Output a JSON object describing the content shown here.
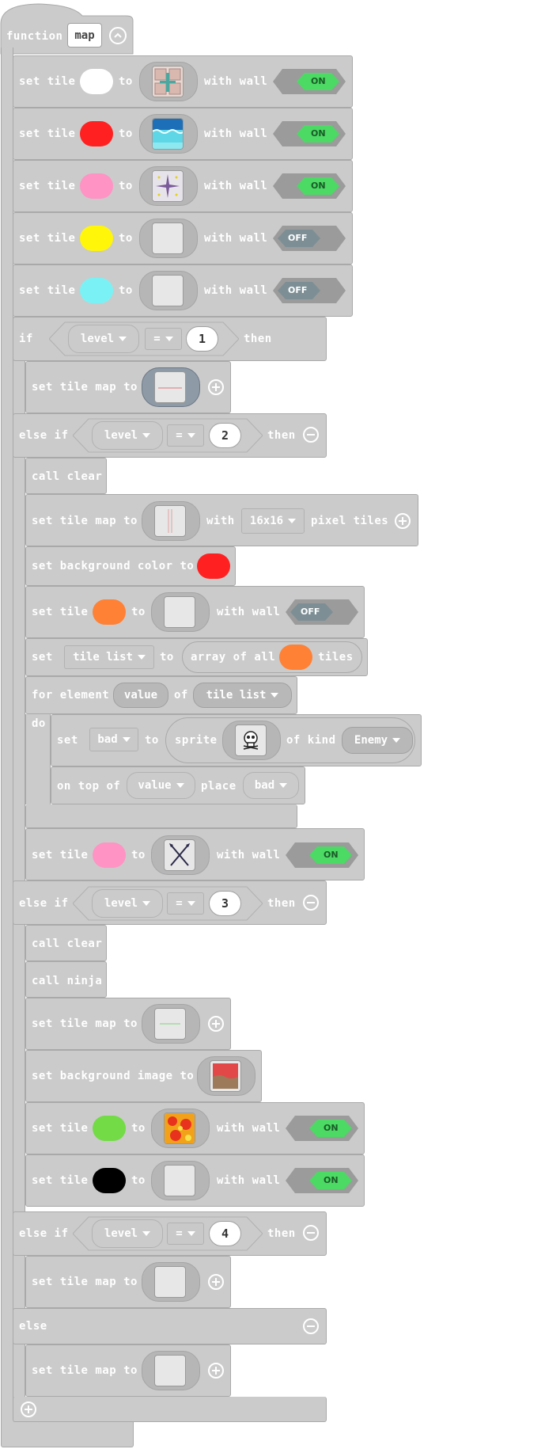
{
  "function": {
    "keyword": "function",
    "name": "map"
  },
  "set_tiles": [
    {
      "prefix": "set tile",
      "color": "#ffffff",
      "to": "to",
      "with_wall": "with wall",
      "wall": "ON",
      "image": "tile-cross"
    },
    {
      "prefix": "set tile",
      "color": "#ff2121",
      "to": "to",
      "with_wall": "with wall",
      "wall": "ON",
      "image": "tile-water"
    },
    {
      "prefix": "set tile",
      "color": "#ff93c4",
      "to": "to",
      "with_wall": "with wall",
      "wall": "ON",
      "image": "tile-star"
    },
    {
      "prefix": "set tile",
      "color": "#fff609",
      "to": "to",
      "with_wall": "with wall",
      "wall": "OFF",
      "image": "tile-empty"
    },
    {
      "prefix": "set tile",
      "color": "#7af2f5",
      "to": "to",
      "with_wall": "with wall",
      "wall": "OFF",
      "image": "tile-empty"
    }
  ],
  "if1": {
    "if": "if",
    "var": "level",
    "op": "=",
    "num": "1",
    "then": "then"
  },
  "if1_body": {
    "set_tilemap": "set tile map to"
  },
  "elif2": {
    "else_if": "else if",
    "var": "level",
    "op": "=",
    "num": "2",
    "then": "then"
  },
  "elif2_body": {
    "call_clear": "call clear",
    "set_tilemap": "set tile map to",
    "with": "with",
    "pixel_size": "16x16",
    "pixel_tiles": "pixel tiles",
    "set_bg_color": "set background color to",
    "bg_color": "#ff2121",
    "set_tile": {
      "prefix": "set tile",
      "color": "#ff8135",
      "to": "to",
      "with_wall": "with wall",
      "wall": "OFF"
    },
    "set_list": {
      "set": "set",
      "var": "tile list",
      "to": "to",
      "array_of_all": "array of all",
      "color": "#ff8135",
      "tiles": "tiles"
    },
    "for_loop": {
      "for_element": "for element",
      "value": "value",
      "of": "of",
      "list": "tile list",
      "do": "do"
    },
    "set_sprite": {
      "set": "set",
      "var": "bad",
      "to": "to",
      "sprite": "sprite",
      "of_kind": "of kind",
      "kind": "Enemy"
    },
    "on_top_of": {
      "on_top_of": "on top of",
      "value": "value",
      "place": "place",
      "sprite": "bad"
    },
    "set_tile2": {
      "prefix": "set tile",
      "color": "#ff93c4",
      "to": "to",
      "with_wall": "with wall",
      "wall": "ON"
    }
  },
  "elif3": {
    "else_if": "else if",
    "var": "level",
    "op": "=",
    "num": "3",
    "then": "then"
  },
  "elif3_body": {
    "call_clear": "call clear",
    "call_ninja": "call ninja",
    "set_tilemap": "set tile map to",
    "set_bg_image": "set background image to",
    "set_tile_a": {
      "prefix": "set tile",
      "color": "#72db46",
      "to": "to",
      "with_wall": "with wall",
      "wall": "ON"
    },
    "set_tile_b": {
      "prefix": "set tile",
      "color": "#000000",
      "to": "to",
      "with_wall": "with wall",
      "wall": "ON"
    }
  },
  "elif4": {
    "else_if": "else if",
    "var": "level",
    "op": "=",
    "num": "4",
    "then": "then"
  },
  "elif4_body": {
    "set_tilemap": "set tile map to"
  },
  "else": {
    "label": "else",
    "set_tilemap": "set tile map to"
  }
}
